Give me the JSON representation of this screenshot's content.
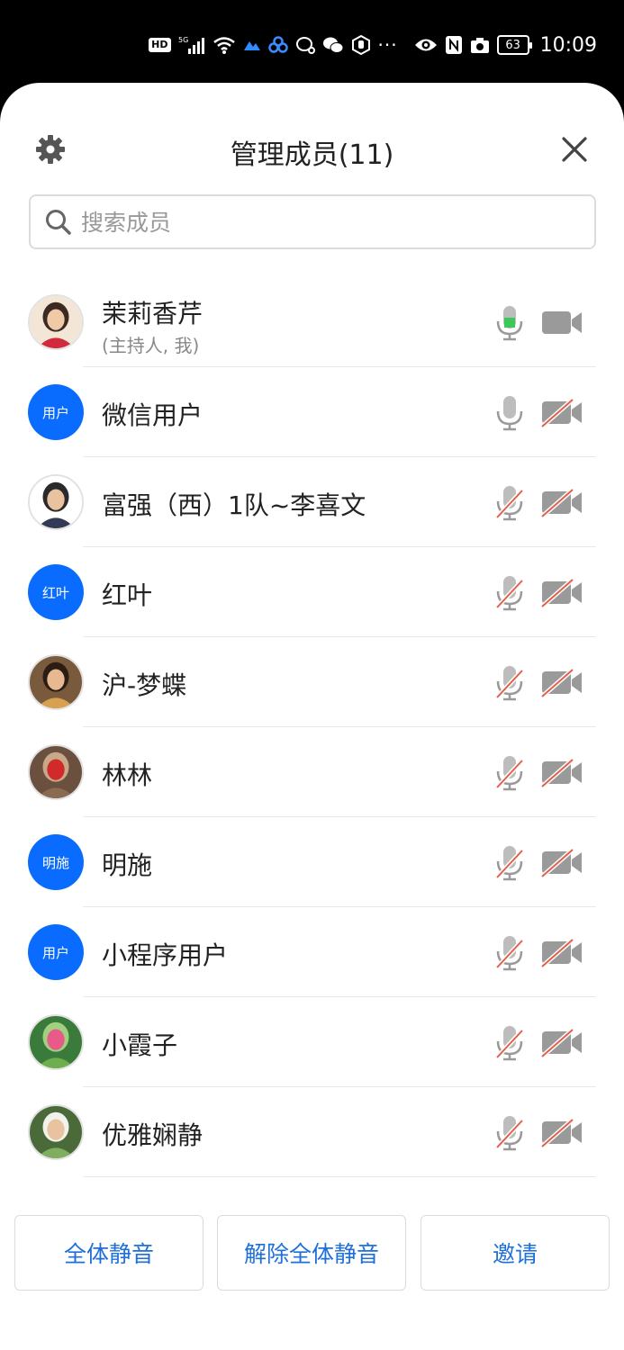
{
  "status_bar": {
    "time": "10:09",
    "battery": "63",
    "hd": "HD",
    "network": "5G",
    "icons": [
      "hd-icon",
      "signal-icon",
      "wifi-icon",
      "app-icon",
      "cloud-icon",
      "message-icon",
      "wechat-icon",
      "hand-icon",
      "more-dots-icon",
      "eye-icon",
      "nfc-icon",
      "camera-icon",
      "battery-icon"
    ]
  },
  "header": {
    "title": "管理成员(11)"
  },
  "search": {
    "placeholder": "搜索成员"
  },
  "colors": {
    "accent": "#0a6cff",
    "link": "#1e6fd9",
    "mic_active": "#3cc85a",
    "muted_slash": "#e0604a",
    "icon_gray": "#9a9a9a"
  },
  "members": [
    {
      "name": "茉莉香芹",
      "role": "(主持人, 我)",
      "avatar_text": "",
      "avatar_type": "photo",
      "mic": "on",
      "cam": "off"
    },
    {
      "name": "微信用户",
      "role": "",
      "avatar_text": "用户",
      "avatar_type": "text",
      "mic": "on-gray",
      "cam": "muted"
    },
    {
      "name": "富强（西）1队~李喜文",
      "role": "",
      "avatar_text": "",
      "avatar_type": "photo",
      "mic": "muted",
      "cam": "muted"
    },
    {
      "name": "红叶",
      "role": "",
      "avatar_text": "红叶",
      "avatar_type": "text",
      "mic": "muted",
      "cam": "muted"
    },
    {
      "name": "沪-梦蝶",
      "role": "",
      "avatar_text": "",
      "avatar_type": "photo",
      "mic": "muted",
      "cam": "muted"
    },
    {
      "name": "林林",
      "role": "",
      "avatar_text": "",
      "avatar_type": "photo",
      "mic": "muted",
      "cam": "muted"
    },
    {
      "name": "明施",
      "role": "",
      "avatar_text": "明施",
      "avatar_type": "text",
      "mic": "muted",
      "cam": "muted"
    },
    {
      "name": "小程序用户",
      "role": "",
      "avatar_text": "用户",
      "avatar_type": "text",
      "mic": "muted",
      "cam": "muted"
    },
    {
      "name": "小霞子",
      "role": "",
      "avatar_text": "",
      "avatar_type": "photo",
      "mic": "muted",
      "cam": "muted"
    },
    {
      "name": "优雅娴静",
      "role": "",
      "avatar_text": "",
      "avatar_type": "photo",
      "mic": "muted",
      "cam": "muted"
    }
  ],
  "footer": {
    "mute_all": "全体静音",
    "unmute_all": "解除全体静音",
    "invite": "邀请"
  }
}
